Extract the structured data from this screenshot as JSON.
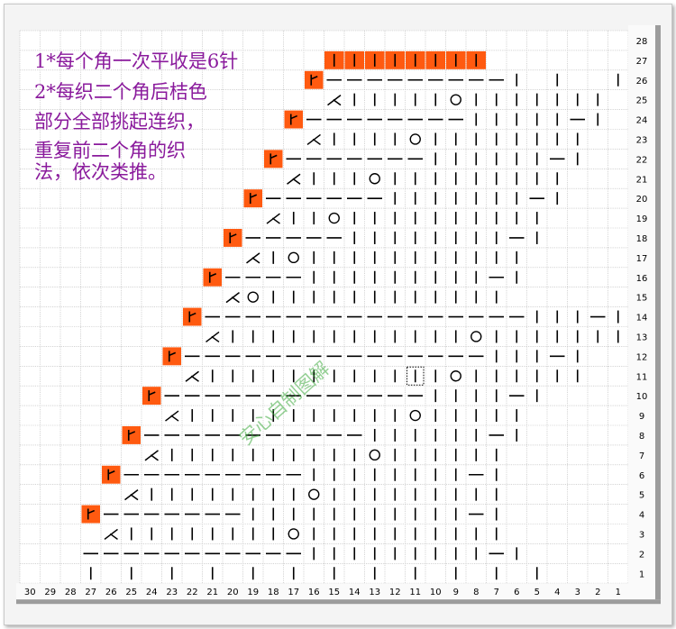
{
  "notes": [
    "1*每个角一次平收是6针",
    "2*每织二个角后桔色",
    "部分全部挑起连织，",
    "重复前二个角的织",
    "法，依次类推。"
  ],
  "watermark": "安心自制图解",
  "colors": {
    "grid": "#b9b9b9",
    "symbol": "#000000",
    "accent": "#ff5a10",
    "note_text": "#8a1a9c",
    "watermark": "#3caa3c",
    "axis_bg": "#9c9c9c"
  },
  "symbols": {
    "knit": "|",
    "purl": "—",
    "yarn_over": "○",
    "k2tog_left": "人",
    "marker": "卜"
  },
  "chart_data": {
    "type": "table",
    "columns": 30,
    "rows": 28,
    "column_numbers": [
      30,
      29,
      28,
      27,
      26,
      25,
      24,
      23,
      22,
      21,
      20,
      19,
      18,
      17,
      16,
      15,
      14,
      13,
      12,
      11,
      10,
      9,
      8,
      7,
      6,
      5,
      4,
      3,
      2,
      1
    ],
    "row_numbers": [
      28,
      27,
      26,
      25,
      24,
      23,
      22,
      21,
      20,
      19,
      18,
      17,
      16,
      15,
      14,
      13,
      12,
      11,
      10,
      9,
      8,
      7,
      6,
      5,
      4,
      3,
      2,
      1
    ],
    "cells": {
      "27": "...............OOOOOOOO.......",
      "26": "..............M---------|.|..|||-|.",
      "25": "...............\\|||||O|||||||.",
      "24": ".............M--------|||||-|.",
      "23": "..............\\||||O||||||||..",
      "22": "............M-------||||||-|..",
      "21": ".............\\|||O|||||||||...",
      "20": "...........M------|||||||-|...",
      "19": "............\\||O||||||||||....",
      "18": "..........M-----||||||||-|....",
      "17": "...........\\|O|||||||||||.....",
      "16": ".........M----|||||||||-|.....",
      "15": "..........\\O||||||||||||......",
      "14": "........M----------------|||-|",
      "13": ".........\\||||||||||||O|||||||",
      "12": ".......M---------------|||-|..",
      "11": "........\\||||||||||B|O||||||..",
      "10": "......M-------------||||-|....",
      "9": ".......\\|||||||||||O|||||....",
      "8": ".....M-----------||||||-|.....",
      "7": "......\\||||||||||O||||||......",
      "6": "....M---------||||||||-|......",
      "5": ".....\\||||||||O|||||||||......",
      "4": "...M-------|||||||||||-|......",
      "3": "....\\||||||||O||||||||||......",
      "2": "...-----------|||||||||-|......",
      "1": "...|.|.|.|.|.|.|.|.|.|.|.|....."
    },
    "legend": {
      "|": "knit",
      "-": "purl",
      "O": "yarn_over",
      "\\": "k2tog_left",
      "M": "marker",
      "B": "boxed_knit"
    }
  }
}
